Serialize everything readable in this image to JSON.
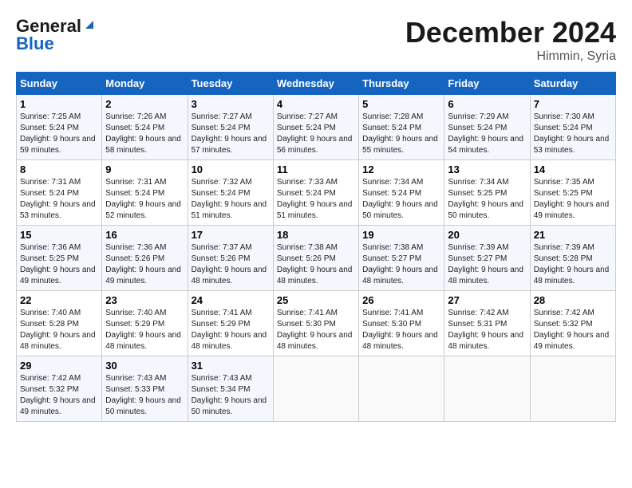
{
  "header": {
    "logo_general": "General",
    "logo_blue": "Blue",
    "month": "December 2024",
    "location": "Himmin, Syria"
  },
  "weekdays": [
    "Sunday",
    "Monday",
    "Tuesday",
    "Wednesday",
    "Thursday",
    "Friday",
    "Saturday"
  ],
  "weeks": [
    [
      {
        "day": "1",
        "sunrise": "7:25 AM",
        "sunset": "5:24 PM",
        "daylight": "9 hours and 59 minutes."
      },
      {
        "day": "2",
        "sunrise": "7:26 AM",
        "sunset": "5:24 PM",
        "daylight": "9 hours and 58 minutes."
      },
      {
        "day": "3",
        "sunrise": "7:27 AM",
        "sunset": "5:24 PM",
        "daylight": "9 hours and 57 minutes."
      },
      {
        "day": "4",
        "sunrise": "7:27 AM",
        "sunset": "5:24 PM",
        "daylight": "9 hours and 56 minutes."
      },
      {
        "day": "5",
        "sunrise": "7:28 AM",
        "sunset": "5:24 PM",
        "daylight": "9 hours and 55 minutes."
      },
      {
        "day": "6",
        "sunrise": "7:29 AM",
        "sunset": "5:24 PM",
        "daylight": "9 hours and 54 minutes."
      },
      {
        "day": "7",
        "sunrise": "7:30 AM",
        "sunset": "5:24 PM",
        "daylight": "9 hours and 53 minutes."
      }
    ],
    [
      {
        "day": "8",
        "sunrise": "7:31 AM",
        "sunset": "5:24 PM",
        "daylight": "9 hours and 53 minutes."
      },
      {
        "day": "9",
        "sunrise": "7:31 AM",
        "sunset": "5:24 PM",
        "daylight": "9 hours and 52 minutes."
      },
      {
        "day": "10",
        "sunrise": "7:32 AM",
        "sunset": "5:24 PM",
        "daylight": "9 hours and 51 minutes."
      },
      {
        "day": "11",
        "sunrise": "7:33 AM",
        "sunset": "5:24 PM",
        "daylight": "9 hours and 51 minutes."
      },
      {
        "day": "12",
        "sunrise": "7:34 AM",
        "sunset": "5:24 PM",
        "daylight": "9 hours and 50 minutes."
      },
      {
        "day": "13",
        "sunrise": "7:34 AM",
        "sunset": "5:25 PM",
        "daylight": "9 hours and 50 minutes."
      },
      {
        "day": "14",
        "sunrise": "7:35 AM",
        "sunset": "5:25 PM",
        "daylight": "9 hours and 49 minutes."
      }
    ],
    [
      {
        "day": "15",
        "sunrise": "7:36 AM",
        "sunset": "5:25 PM",
        "daylight": "9 hours and 49 minutes."
      },
      {
        "day": "16",
        "sunrise": "7:36 AM",
        "sunset": "5:26 PM",
        "daylight": "9 hours and 49 minutes."
      },
      {
        "day": "17",
        "sunrise": "7:37 AM",
        "sunset": "5:26 PM",
        "daylight": "9 hours and 48 minutes."
      },
      {
        "day": "18",
        "sunrise": "7:38 AM",
        "sunset": "5:26 PM",
        "daylight": "9 hours and 48 minutes."
      },
      {
        "day": "19",
        "sunrise": "7:38 AM",
        "sunset": "5:27 PM",
        "daylight": "9 hours and 48 minutes."
      },
      {
        "day": "20",
        "sunrise": "7:39 AM",
        "sunset": "5:27 PM",
        "daylight": "9 hours and 48 minutes."
      },
      {
        "day": "21",
        "sunrise": "7:39 AM",
        "sunset": "5:28 PM",
        "daylight": "9 hours and 48 minutes."
      }
    ],
    [
      {
        "day": "22",
        "sunrise": "7:40 AM",
        "sunset": "5:28 PM",
        "daylight": "9 hours and 48 minutes."
      },
      {
        "day": "23",
        "sunrise": "7:40 AM",
        "sunset": "5:29 PM",
        "daylight": "9 hours and 48 minutes."
      },
      {
        "day": "24",
        "sunrise": "7:41 AM",
        "sunset": "5:29 PM",
        "daylight": "9 hours and 48 minutes."
      },
      {
        "day": "25",
        "sunrise": "7:41 AM",
        "sunset": "5:30 PM",
        "daylight": "9 hours and 48 minutes."
      },
      {
        "day": "26",
        "sunrise": "7:41 AM",
        "sunset": "5:30 PM",
        "daylight": "9 hours and 48 minutes."
      },
      {
        "day": "27",
        "sunrise": "7:42 AM",
        "sunset": "5:31 PM",
        "daylight": "9 hours and 48 minutes."
      },
      {
        "day": "28",
        "sunrise": "7:42 AM",
        "sunset": "5:32 PM",
        "daylight": "9 hours and 49 minutes."
      }
    ],
    [
      {
        "day": "29",
        "sunrise": "7:42 AM",
        "sunset": "5:32 PM",
        "daylight": "9 hours and 49 minutes."
      },
      {
        "day": "30",
        "sunrise": "7:43 AM",
        "sunset": "5:33 PM",
        "daylight": "9 hours and 50 minutes."
      },
      {
        "day": "31",
        "sunrise": "7:43 AM",
        "sunset": "5:34 PM",
        "daylight": "9 hours and 50 minutes."
      },
      null,
      null,
      null,
      null
    ]
  ],
  "labels": {
    "sunrise": "Sunrise:",
    "sunset": "Sunset:",
    "daylight": "Daylight:"
  }
}
